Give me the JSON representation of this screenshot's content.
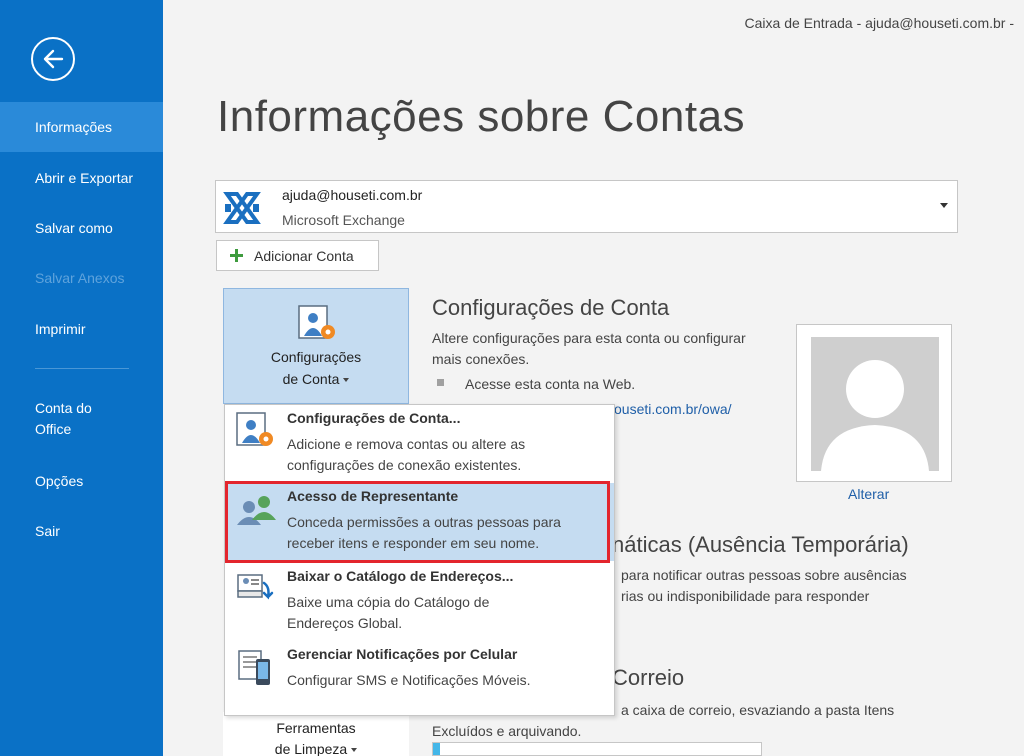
{
  "window": {
    "title": "Caixa de Entrada - ajuda@houseti.com.br -"
  },
  "sidebar": {
    "items": [
      {
        "label": "Informações",
        "active": true
      },
      {
        "label": "Abrir e Exportar"
      },
      {
        "label": "Salvar como"
      },
      {
        "label": "Salvar Anexos",
        "disabled": true
      },
      {
        "label": "Imprimir"
      },
      {
        "label": "Conta do Office"
      },
      {
        "label": "Opções"
      },
      {
        "label": "Sair"
      }
    ]
  },
  "page": {
    "title": "Informações sobre Contas"
  },
  "account": {
    "email": "ajuda@houseti.com.br",
    "type": "Microsoft Exchange",
    "add_label": "Adicionar Conta"
  },
  "config_button": {
    "line1": "Configurações",
    "line2": "de Conta"
  },
  "account_settings": {
    "title": "Configurações de Conta",
    "desc_line1": "Altere configurações para esta conta ou configurar",
    "desc_line2": "mais conexões.",
    "bullet": "Acesse esta conta na Web.",
    "link": "ouseti.com.br/owa/"
  },
  "photo": {
    "change_label": "Alterar"
  },
  "auto_reply": {
    "title": "náticas (Ausência Temporária)",
    "desc_line1": "para notificar outras pessoas sobre ausências",
    "desc_line2": "rias ou indisponibilidade para responder"
  },
  "mailbox": {
    "title": "Correio",
    "desc_line1": "a caixa de correio, esvaziando a pasta Itens",
    "desc_line2": "Excluídos e arquivando.",
    "usage_fraction": 0.02
  },
  "tools_button": {
    "line1": "Ferramentas",
    "line2": "de Limpeza"
  },
  "dropdown": {
    "items": [
      {
        "title": "Configurações de Conta...",
        "desc_line1": "Adicione e remova contas ou altere as",
        "desc_line2": "configurações de conexão existentes."
      },
      {
        "title": "Acesso de Representante",
        "desc_line1": "Conceda permissões a outras pessoas para",
        "desc_line2": "receber itens e responder em seu nome.",
        "highlighted": true
      },
      {
        "title": "Baixar o Catálogo de Endereços...",
        "desc_line1": "Baixe uma cópia do Catálogo de",
        "desc_line2": "Endereços Global."
      },
      {
        "title": "Gerenciar Notificações por Celular",
        "desc_line1": "Configurar SMS e Notificações Móveis."
      }
    ]
  },
  "colors": {
    "sidebar_bg": "#0a71c6",
    "sidebar_active": "#2a8ad9",
    "highlight_bg": "#c5dcf1",
    "highlight_border": "#e3252d",
    "link": "#1f5fa8"
  }
}
